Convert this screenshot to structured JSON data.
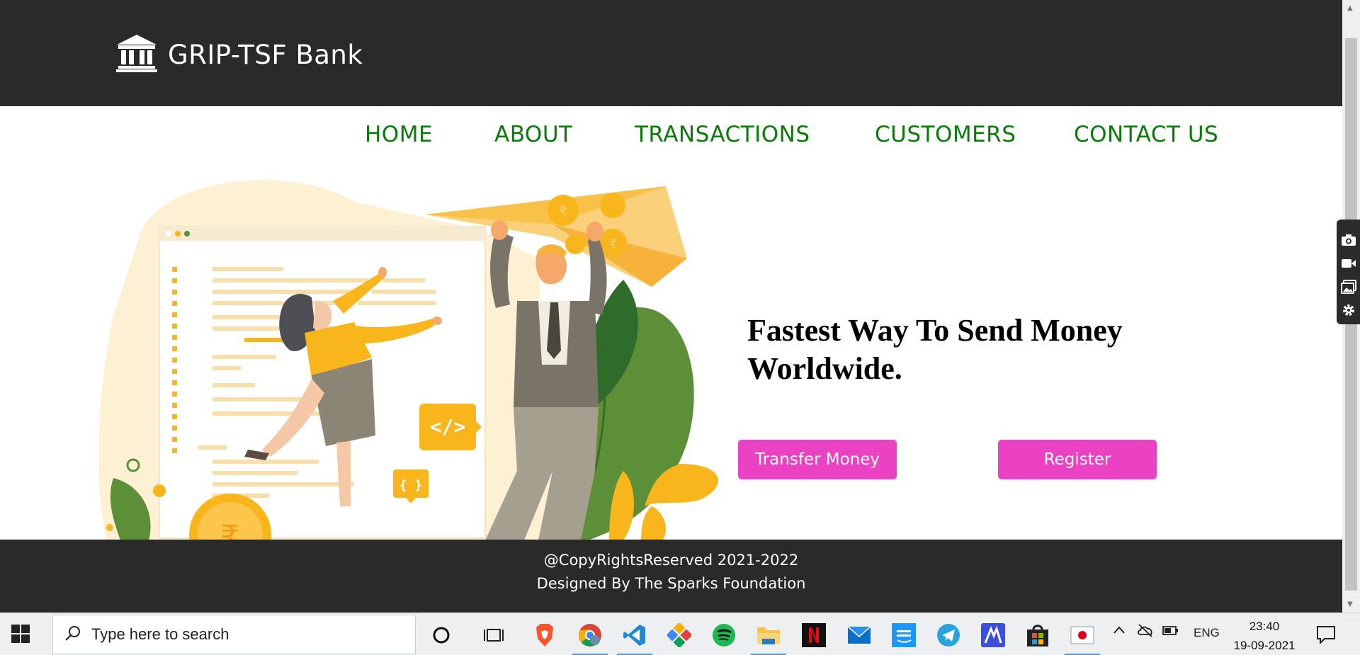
{
  "header": {
    "title": "GRIP-TSF Bank",
    "logo_icon": "bank-building-icon"
  },
  "nav": {
    "items": [
      {
        "label": "HOME"
      },
      {
        "label": "ABOUT"
      },
      {
        "label": "TRANSACTIONS"
      },
      {
        "label": "CUSTOMERS"
      },
      {
        "label": "CONTACT US"
      }
    ]
  },
  "hero": {
    "headline": "Fastest Way To Send Money Worldwide.",
    "transfer_label": "Transfer Money",
    "register_label": "Register",
    "illustration": "people-sending-money-illustration",
    "code_badge": "</>",
    "brace_badge": "{ }",
    "currency_symbol": "₹"
  },
  "footer": {
    "line1": "@CopyRightsReserved 2021-2022",
    "line2": "Designed By The Sparks Foundation"
  },
  "taskbar": {
    "search_placeholder": "Type here to search",
    "language": "ENG",
    "time": "23:40",
    "date": "19-09-2021",
    "apps": [
      "cortana-icon",
      "task-view-icon",
      "brave-icon",
      "chrome-icon",
      "vscode-icon",
      "sourcetree-icon",
      "spotify-icon",
      "file-explorer-icon",
      "netflix-icon",
      "mail-icon",
      "prime-video-icon",
      "telegram-icon",
      "meet-app-icon",
      "store-icon",
      "flag-app-icon"
    ]
  },
  "colors": {
    "header_bg": "#2b2a2a",
    "nav_text": "#0a7a0a",
    "button_bg": "#ea42c3",
    "accent_yellow": "#f8b51c"
  }
}
